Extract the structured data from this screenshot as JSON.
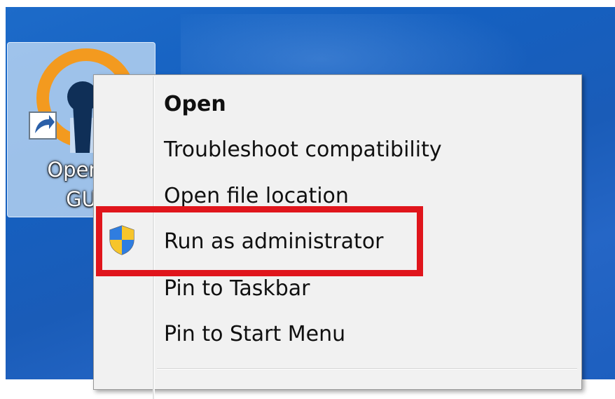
{
  "colors": {
    "desktop_blue": "#1560c0",
    "menu_background": "#f1f1f1",
    "highlight_red": "#e0151c"
  },
  "desktop_icon": {
    "name": "openvpn-gui-shortcut",
    "icon": "openvpn-icon",
    "overlay_icon": "shortcut-arrow-icon",
    "label_line1": "OpenV",
    "label_line2": "GU"
  },
  "context_menu": {
    "items": [
      {
        "label": "Open",
        "bold": true
      },
      {
        "label": "Troubleshoot compatibility"
      },
      {
        "label": "Open file location"
      },
      {
        "label": "Run as administrator",
        "icon": "uac-shield-icon",
        "highlighted": true
      },
      {
        "label": "Pin to Taskbar"
      },
      {
        "label": "Pin to Start Menu"
      }
    ]
  }
}
